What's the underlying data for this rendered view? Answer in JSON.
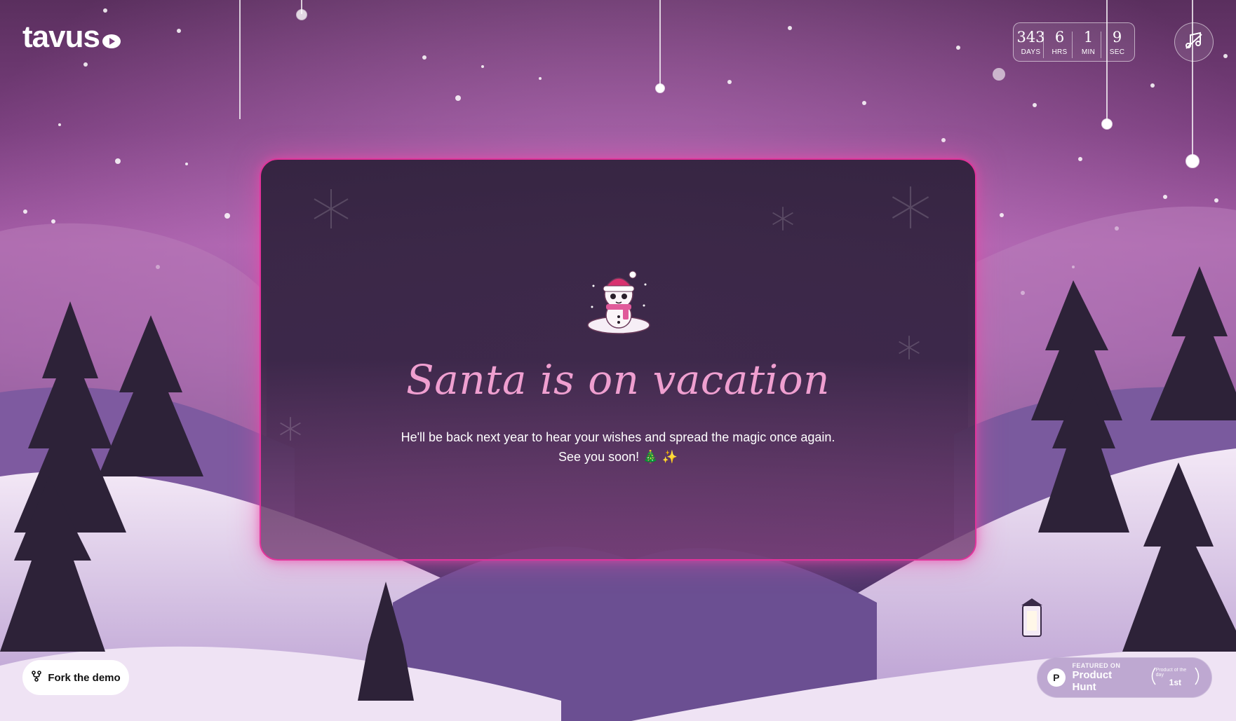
{
  "brand": {
    "name": "tavus"
  },
  "countdown": {
    "units": [
      {
        "value": "343",
        "label": "DAYS"
      },
      {
        "value": "6",
        "label": "HRS"
      },
      {
        "value": "1",
        "label": "MIN"
      },
      {
        "value": "9",
        "label": "SEC"
      }
    ]
  },
  "music_button": {
    "icon": "music-note-icon"
  },
  "card": {
    "title": "Santa is on vacation",
    "line1": "He'll be back next year to hear your wishes and spread the magic once again.",
    "line2": "See you soon! 🎄 ✨",
    "mascot_icon": "snowman-icon"
  },
  "fork_button": {
    "label": "Fork the demo",
    "icon": "fork-icon"
  },
  "product_hunt": {
    "logo_letter": "P",
    "featured": "FEATURED ON",
    "name": "Product Hunt",
    "award_caption": "Product of the day",
    "award_rank": "1st"
  },
  "colors": {
    "accent": "#e0339a",
    "title": "#ef9fd0"
  }
}
